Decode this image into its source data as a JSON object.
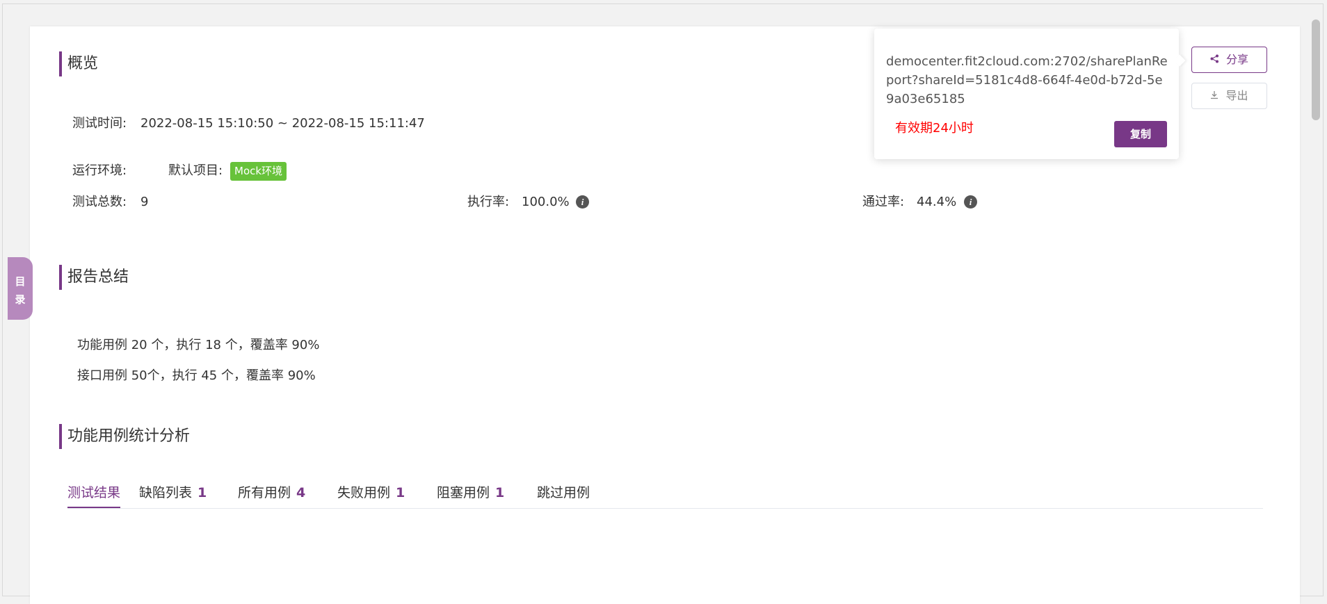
{
  "overview": {
    "title": "概览",
    "test_time_label": "测试时间:",
    "test_time_value": "2022-08-15 15:10:50 ~ 2022-08-15 15:11:47",
    "env_label": "运行环境:",
    "env_project": "默认项目:",
    "env_tag": "Mock环境",
    "total_label": "测试总数:",
    "total_value": "9",
    "exec_rate_label": "执行率:",
    "exec_rate_value": "100.0%",
    "pass_rate_label": "通过率:",
    "pass_rate_value": "44.4%"
  },
  "summary": {
    "title": "报告总结",
    "line1": "功能用例 20 个，执行 18 个，覆盖率 90%",
    "line2": "接口用例 50个，执行 45 个，覆盖率 90%"
  },
  "analysis": {
    "title": "功能用例统计分析",
    "tabs": [
      {
        "label": "测试结果",
        "count": ""
      },
      {
        "label": "缺陷列表",
        "count": "1"
      },
      {
        "label": "所有用例",
        "count": "4"
      },
      {
        "label": "失败用例",
        "count": "1"
      },
      {
        "label": "阻塞用例",
        "count": "1"
      },
      {
        "label": "跳过用例",
        "count": ""
      }
    ]
  },
  "side_tab": {
    "line1": "目",
    "line2": "录"
  },
  "actions": {
    "share": "分享",
    "export": "导出"
  },
  "popover": {
    "url": "democenter.fit2cloud.com:2702/sharePlanReport?shareId=5181c4d8-664f-4e0d-b72d-5e9a03e65185",
    "validity": "有效期24小时",
    "copy": "复制"
  },
  "colors": {
    "accent": "#783887",
    "tag_green": "#67c23a",
    "warning_red": "#ff0000"
  }
}
